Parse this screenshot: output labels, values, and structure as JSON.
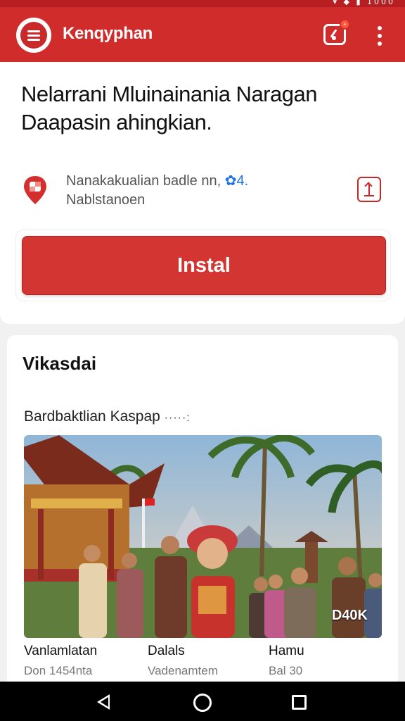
{
  "app": {
    "title": "Kenqyphan"
  },
  "header": {
    "headline": "Nelarrani Mluinainania Naragan Daapasin ahingkian."
  },
  "location": {
    "line1": "Nanakakualian badle nn,",
    "rating": "4.",
    "line2": "Nablstanoen"
  },
  "install": {
    "label": "Instal"
  },
  "section": {
    "title": "Vikasdai",
    "subtitle": "Bardbaktlian Kaspap",
    "subtitle_dots": "·····:",
    "photo_tag": "D40K"
  },
  "captions": [
    {
      "title": "Vanlamlatan",
      "subtitle": "Don 1454nta"
    },
    {
      "title": "Dalals",
      "subtitle": "Vadenamtem"
    },
    {
      "title": "Hamu",
      "subtitle": "Bal 30"
    }
  ],
  "status_icons": "▾ ◆ ▮ 1000",
  "colors": {
    "brand": "#d12c2c",
    "brand_dark": "#b71f22",
    "button": "#d33532",
    "rating_star": "#1a73e8"
  }
}
